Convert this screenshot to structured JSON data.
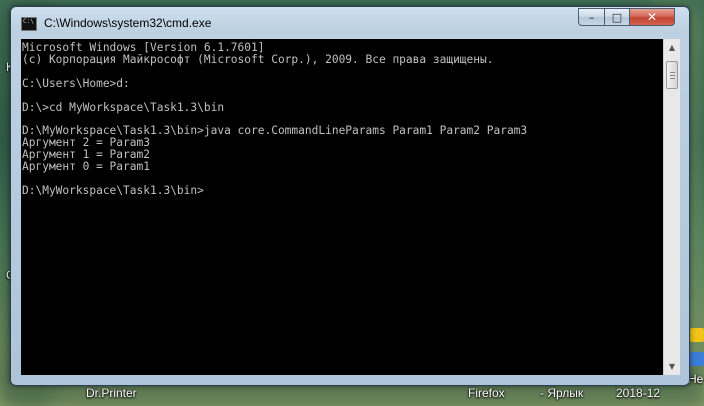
{
  "window": {
    "title": "C:\\Windows\\system32\\cmd.exe",
    "buttons": {
      "minimize": "–",
      "maximize": "□",
      "close": "✕"
    }
  },
  "console": {
    "lines": [
      "Microsoft Windows [Version 6.1.7601]",
      "(c) Корпорация Майкрософт (Microsoft Corp.), 2009. Все права защищены.",
      "",
      "C:\\Users\\Home>d:",
      "",
      "D:\\>cd MyWorkspace\\Task1.3\\bin",
      "",
      "D:\\MyWorkspace\\Task1.3\\bin>java core.CommandLineParams Param1 Param2 Param3",
      "Аргумент 2 = Param3",
      "Аргумент 1 = Param2",
      "Аргумент 0 = Param1",
      "",
      "D:\\MyWorkspace\\Task1.3\\bin>"
    ]
  },
  "desktop": {
    "labels": {
      "dr_printer": "Dr.Printer",
      "firefox": "Firefox",
      "shortcut": "- Ярлык",
      "date": "2018-12",
      "left_k": "K",
      "left_g": "G",
      "right_ne": "Не"
    }
  },
  "colors": {
    "console_bg": "#000000",
    "console_fg": "#c0c0c0",
    "close_button": "#c14432",
    "window_frame": "#bdd1e2"
  }
}
